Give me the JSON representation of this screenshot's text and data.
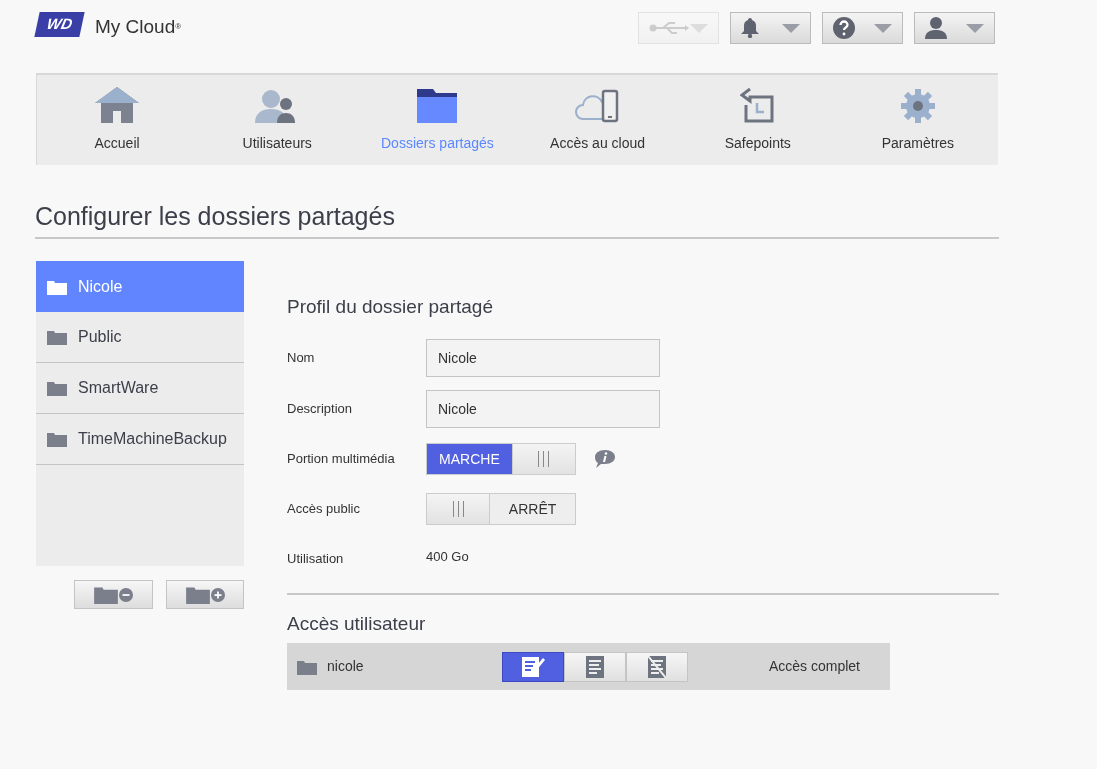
{
  "header": {
    "logo": "WD",
    "product": "My Cloud",
    "product_mark": "®",
    "usb_disabled": true
  },
  "nav": [
    {
      "label": "Accueil",
      "selected": false
    },
    {
      "label": "Utilisateurs",
      "selected": false
    },
    {
      "label": "Dossiers partagés",
      "selected": true
    },
    {
      "label": "Accès au cloud",
      "selected": false
    },
    {
      "label": "Safepoints",
      "selected": false
    },
    {
      "label": "Paramètres",
      "selected": false
    }
  ],
  "page_title": "Configurer les dossiers partagés",
  "shares": [
    {
      "name": "Nicole",
      "selected": true
    },
    {
      "name": "Public",
      "selected": false
    },
    {
      "name": "SmartWare",
      "selected": false
    },
    {
      "name": "TimeMachineBackup",
      "selected": false
    }
  ],
  "profile": {
    "title": "Profil du dossier partagé",
    "fields": [
      {
        "kind": "input",
        "label": "Nom",
        "value": "Nicole"
      },
      {
        "kind": "input",
        "label": "Description",
        "value": "Nicole"
      },
      {
        "kind": "toggle",
        "label": "Portion multimédia",
        "on": true,
        "state_label": "MARCHE",
        "info": true
      },
      {
        "kind": "toggle",
        "label": "Accès public",
        "on": false,
        "state_label": "ARRÊT",
        "info": false
      },
      {
        "kind": "text",
        "label": "Utilisation",
        "value": "400 Go"
      }
    ]
  },
  "user_access": {
    "title": "Accès utilisateur",
    "rows": [
      {
        "user": "nicole",
        "permissions": [
          {
            "selected": true
          },
          {
            "selected": false
          },
          {
            "selected": false
          }
        ],
        "access_label": "Accès complet"
      }
    ]
  }
}
